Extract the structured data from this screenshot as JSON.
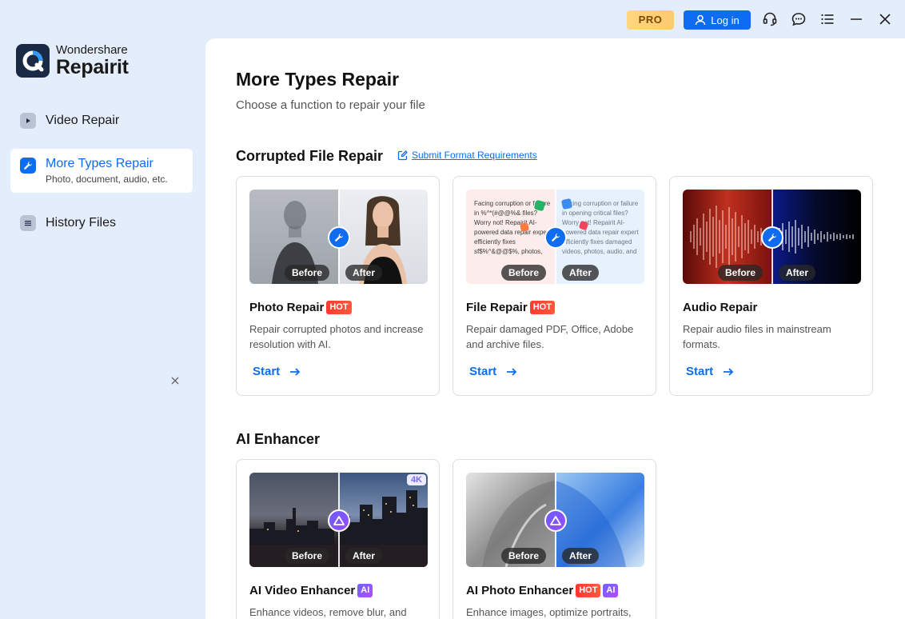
{
  "titlebar": {
    "pro_label": "PRO",
    "login_label": "Log in"
  },
  "brand": {
    "sub": "Wondershare",
    "main": "Repairit"
  },
  "sidebar": {
    "items": [
      {
        "label": "Video Repair"
      },
      {
        "label": "More Types Repair",
        "sub": "Photo, document, audio, etc."
      },
      {
        "label": "History Files"
      }
    ]
  },
  "main": {
    "title": "More Types Repair",
    "subtitle": "Choose a function to repair your file",
    "sections": [
      {
        "title": "Corrupted File Repair",
        "link": "Submit Format Requirements",
        "cards": [
          {
            "title": "Photo Repair",
            "tag": "HOT",
            "desc": "Repair corrupted photos and increase resolution with AI.",
            "start": "Start",
            "before": "Before",
            "after": "After"
          },
          {
            "title": "File Repair",
            "tag": "HOT",
            "desc": "Repair damaged PDF, Office, Adobe and archive files.",
            "start": "Start",
            "before": "Before",
            "after": "After",
            "doc_before": "Facing corruption or failure in %^*(#@@%& files? Worry not! Repairit AI-powered data repair expert efficiently fixes sf$%^&@@$%, photos,",
            "doc_after": "Facing corruption or failure in opening critical files? Worry not! Repairit AI-powered data repair expert efficiently fixes damaged videos, photos, audio, and"
          },
          {
            "title": "Audio Repair",
            "desc": "Repair audio files in mainstream formats.",
            "start": "Start",
            "before": "Before",
            "after": "After"
          }
        ]
      },
      {
        "title": "AI Enhancer",
        "cards": [
          {
            "title": "AI Video Enhancer",
            "tag_ai": "AI",
            "desc": "Enhance videos, remove blur, and",
            "before": "Before",
            "after": "After",
            "badge": "4K"
          },
          {
            "title": "AI Photo Enhancer",
            "tag": "HOT",
            "tag_ai": "AI",
            "desc": "Enhance images, optimize portraits,",
            "before": "Before",
            "after": "After"
          }
        ]
      }
    ]
  },
  "colors": {
    "accent": "#0d6cf0",
    "sidebar_bg": "#e3edfc",
    "hot": "#ff3a2f",
    "pro": "#ffd77f"
  }
}
